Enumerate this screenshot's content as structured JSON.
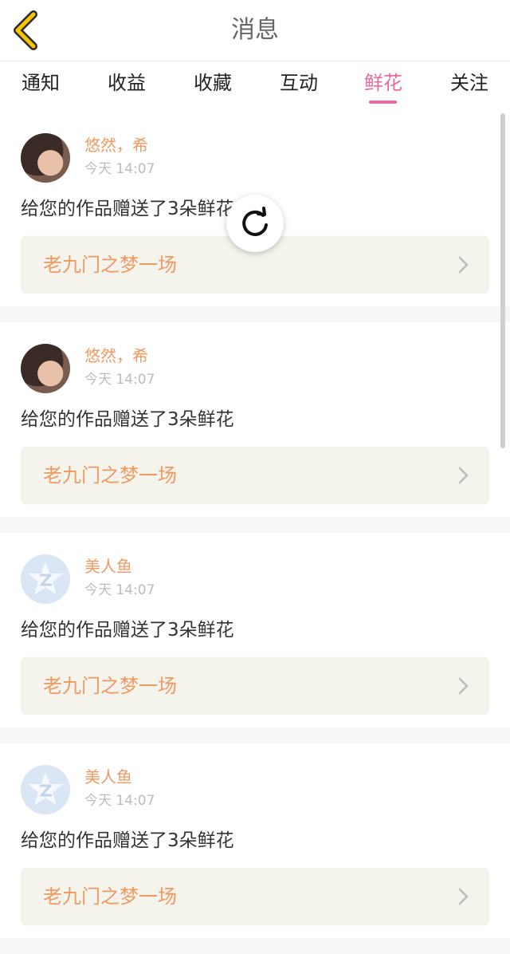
{
  "header": {
    "title": "消息",
    "back_icon": "chevron-left-icon",
    "accent_color": "#f7c600"
  },
  "tabs": [
    {
      "label": "通知",
      "active": false
    },
    {
      "label": "收益",
      "active": false
    },
    {
      "label": "收藏",
      "active": false
    },
    {
      "label": "互动",
      "active": false
    },
    {
      "label": "鲜花",
      "active": true
    },
    {
      "label": "关注",
      "active": false
    }
  ],
  "messages": [
    {
      "user": "悠然，希",
      "time": "今天 14:07",
      "text": "给您的作品赠送了3朵鲜花",
      "work": "老九门之梦一场",
      "avatar": "photo"
    },
    {
      "user": "悠然，希",
      "time": "今天 14:07",
      "text": "给您的作品赠送了3朵鲜花",
      "work": "老九门之梦一场",
      "avatar": "photo"
    },
    {
      "user": "美人鱼",
      "time": "今天 14:07",
      "text": "给您的作品赠送了3朵鲜花",
      "work": "老九门之梦一场",
      "avatar": "default"
    },
    {
      "user": "美人鱼",
      "time": "今天 14:07",
      "text": "给您的作品赠送了3朵鲜花",
      "work": "老九门之梦一场",
      "avatar": "default"
    }
  ],
  "colors": {
    "accent_pink": "#e86aa0",
    "name_orange": "#f09a62",
    "card_bg": "#f4f4ec"
  },
  "refresh_icon": "refresh-icon"
}
